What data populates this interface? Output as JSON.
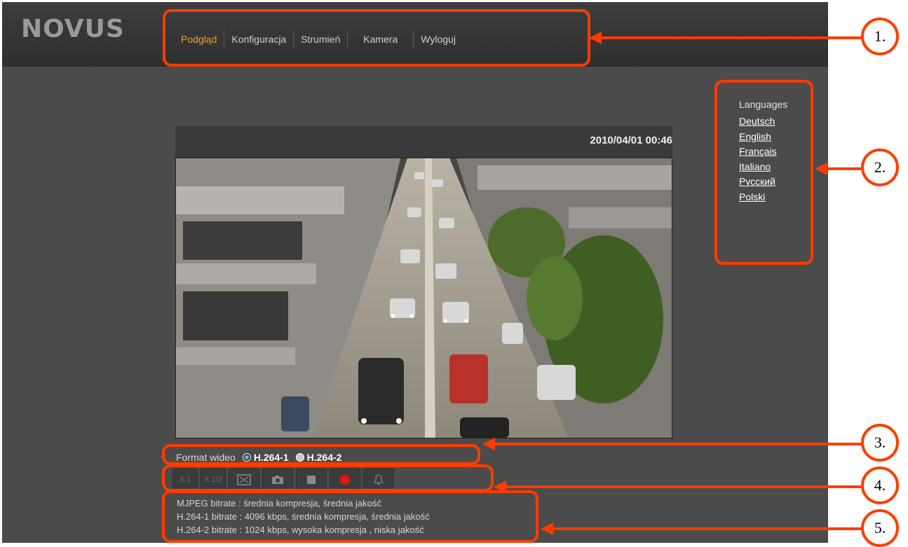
{
  "logo": "NOVUS",
  "nav": [
    "Podgląd",
    "Konfiguracja",
    "Strumień",
    "Kamera",
    "Wyloguj"
  ],
  "nav_active": "Podgląd",
  "languages": {
    "title": "Languages",
    "items": [
      "Deutsch",
      "English",
      "Français",
      "Italiano",
      "Русский",
      "Polski"
    ]
  },
  "viewer": {
    "timestamp": "2010/04/01 00:46"
  },
  "format": {
    "label": "Format wideo",
    "options": [
      "H.264-1",
      "H.264-2"
    ],
    "selected": "H.264-1"
  },
  "toolbar": {
    "buttons": [
      "X 1",
      "X 1/2",
      "fullscreen-icon",
      "camera-icon",
      "stop-icon",
      "record-icon",
      "alarm-icon"
    ]
  },
  "info": [
    "MJPEG bitrate : średnia kompresja, średnia jakość",
    "H.264-1 bitrate : 4096 kbps, średnia kompresja, średnia jakość",
    "H.264-2 bitrate : 1024 kbps, wysoka kompresja , niska jakość"
  ],
  "callouts": [
    "1.",
    "2.",
    "3.",
    "4.",
    "5."
  ],
  "colors": {
    "accent_orange": "#ff3c00",
    "active_nav": "#e2a23a"
  }
}
